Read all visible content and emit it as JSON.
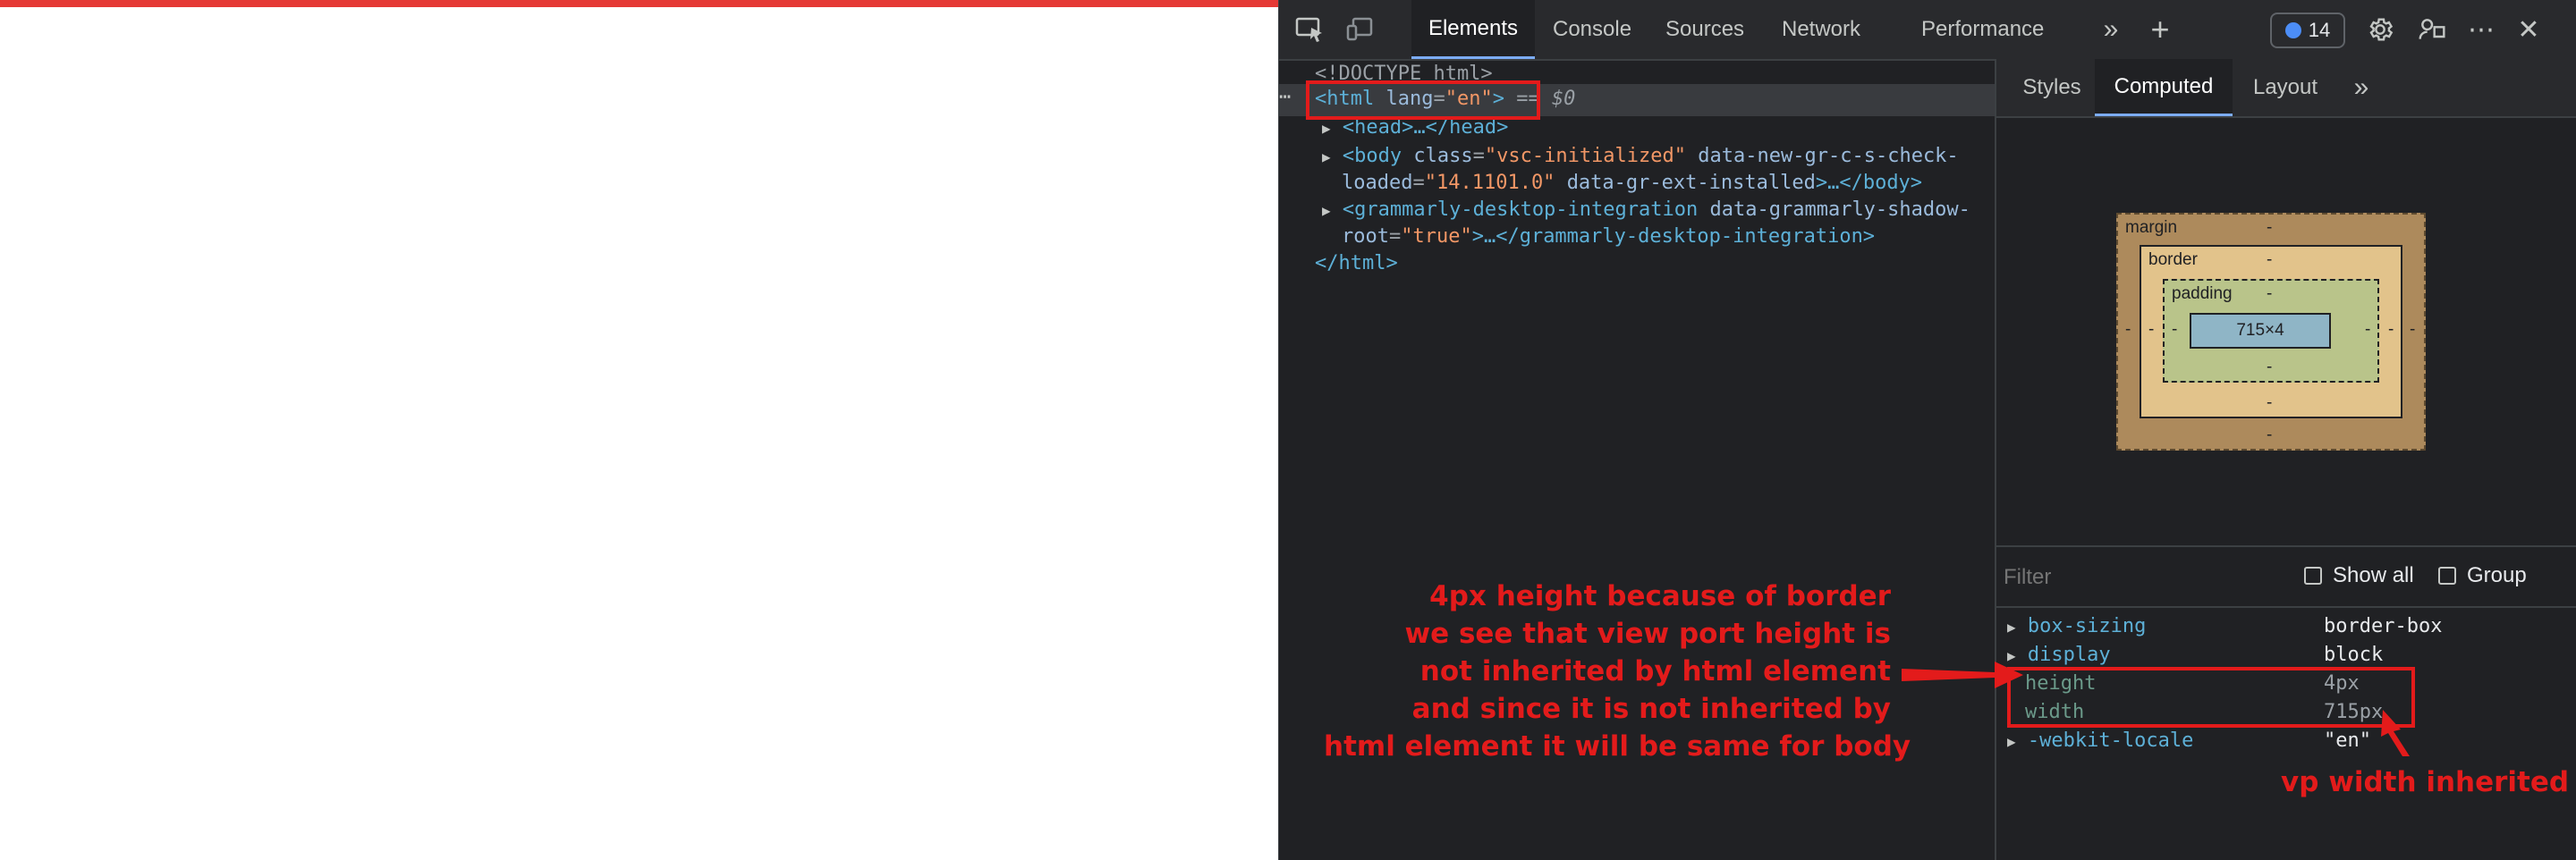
{
  "toolbar": {
    "tabs": [
      "Elements",
      "Console",
      "Sources",
      "Network",
      "Performance"
    ],
    "badge_count": "14"
  },
  "dom": {
    "doctype": "<!DOCTYPE html>",
    "html_open": "<html",
    "html_attr": "lang",
    "html_val": "\"en\"",
    "html_close": ">",
    "selected_marker": "== $0",
    "head": "<head>…</head>",
    "body_open": "<body",
    "body_attr1": "class",
    "body_val1": "\"vsc-initialized\"",
    "body_attr2": "data-new-gr-c-s-check-",
    "body_attr2b": "loaded",
    "body_val2": "\"14.1101.0\"",
    "body_attr3": "data-gr-ext-installed",
    "body_rest": ">…</body>",
    "gd_open": "<grammarly-desktop-integration",
    "gd_attr": "data-grammarly-shadow-",
    "gd_attr_b": "root",
    "gd_val": "\"true\"",
    "gd_rest": ">…</grammarly-desktop-integration>",
    "html_end": "</html>"
  },
  "side_tabs": [
    "Styles",
    "Computed",
    "Layout"
  ],
  "box_model": {
    "margin_label": "margin",
    "border_label": "border",
    "padding_label": "padding",
    "content": "715×4",
    "dash": "-"
  },
  "filter": {
    "placeholder": "Filter",
    "show_all": "Show all",
    "group": "Group"
  },
  "properties": [
    {
      "name": "box-sizing",
      "value": "border-box"
    },
    {
      "name": "display",
      "value": "block"
    },
    {
      "name": "height",
      "value": "4px"
    },
    {
      "name": "width",
      "value": "715px"
    },
    {
      "name": "-webkit-locale",
      "value": "\"en\""
    }
  ],
  "annotations": {
    "main_lines": [
      "4px height because of border",
      "we see that view port height is",
      "not inherited by html element",
      "and since it is not inherited by",
      "html element it will be same for body"
    ],
    "vp_note": "vp width inherited"
  },
  "colors": {
    "annotation": "#e31b1b",
    "page_border": "#e53935",
    "devtools_bg": "#202124"
  }
}
